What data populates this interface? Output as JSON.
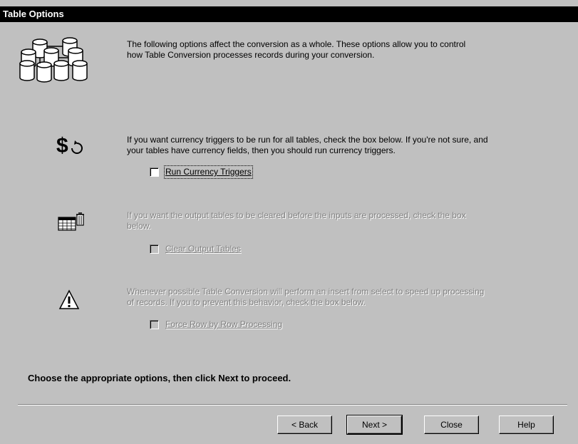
{
  "window": {
    "title": "Table Options"
  },
  "intro": {
    "line1": "The following options affect the conversion as a whole.  These options allow you to control",
    "line2": "how Table Conversion processes records during your conversion."
  },
  "currency": {
    "line1": "If you want currency triggers to be run for all tables, check the box below.  If you're not sure, and",
    "line2": "your tables have currency fields, then you should run currency triggers.",
    "checkbox_label": "Run Currency Triggers",
    "checked": false,
    "enabled": true
  },
  "clear_output": {
    "line1": "If you want the output tables to be cleared before the inputs are processed, check the box",
    "line2": "below.",
    "checkbox_label": "Clear Output Tables",
    "checked": false,
    "enabled": false
  },
  "row_by_row": {
    "line1": "Whenever possible Table Conversion will perform an insert from select to speed up processing",
    "line2": "of records.  If you to prevent this behavior, check the box below.",
    "checkbox_label": "Force Row by Row Processing",
    "checked": false,
    "enabled": false
  },
  "instruction": "Choose the appropriate options, then click Next to proceed.",
  "buttons": {
    "back": "< Back",
    "next": "Next >",
    "close": "Close",
    "help": "Help"
  },
  "icons": {
    "database": "database-cluster-icon",
    "currency": "currency-refresh-icon",
    "clear": "table-trash-icon",
    "warning": "warning-icon"
  }
}
